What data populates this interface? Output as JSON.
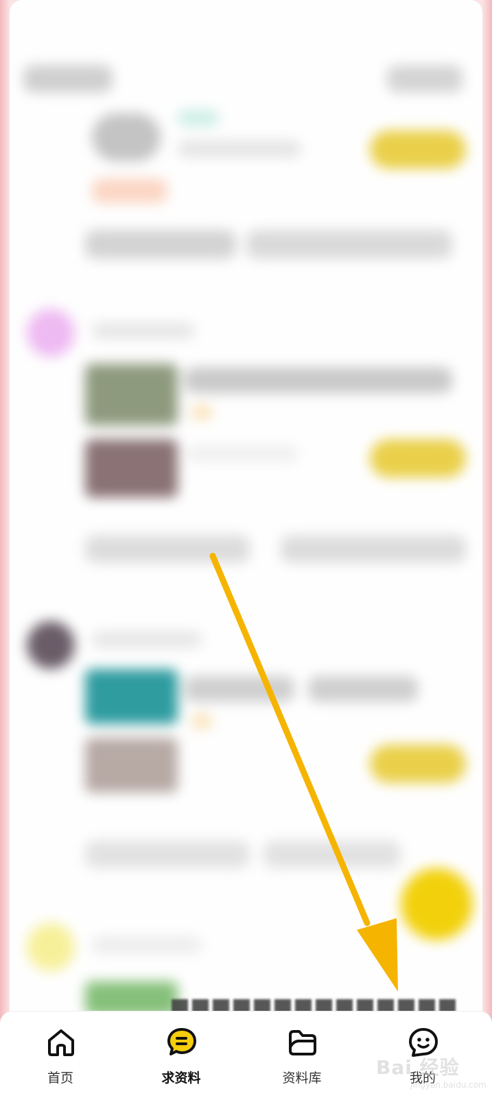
{
  "nav": {
    "items": [
      {
        "label": "首页",
        "icon": "home-icon",
        "active": false
      },
      {
        "label": "求资料",
        "icon": "chat-bubble-icon",
        "active": true
      },
      {
        "label": "资料库",
        "icon": "folder-icon",
        "active": false
      },
      {
        "label": "我的",
        "icon": "smiley-face-icon",
        "active": false
      }
    ]
  },
  "colors": {
    "accent_yellow": "#f5cd0c",
    "arrow": "#f5b400",
    "border_pink": "#f3b9bd"
  },
  "watermark": {
    "brand": "Bai 经验",
    "url": "jingyan.baidu.com"
  }
}
